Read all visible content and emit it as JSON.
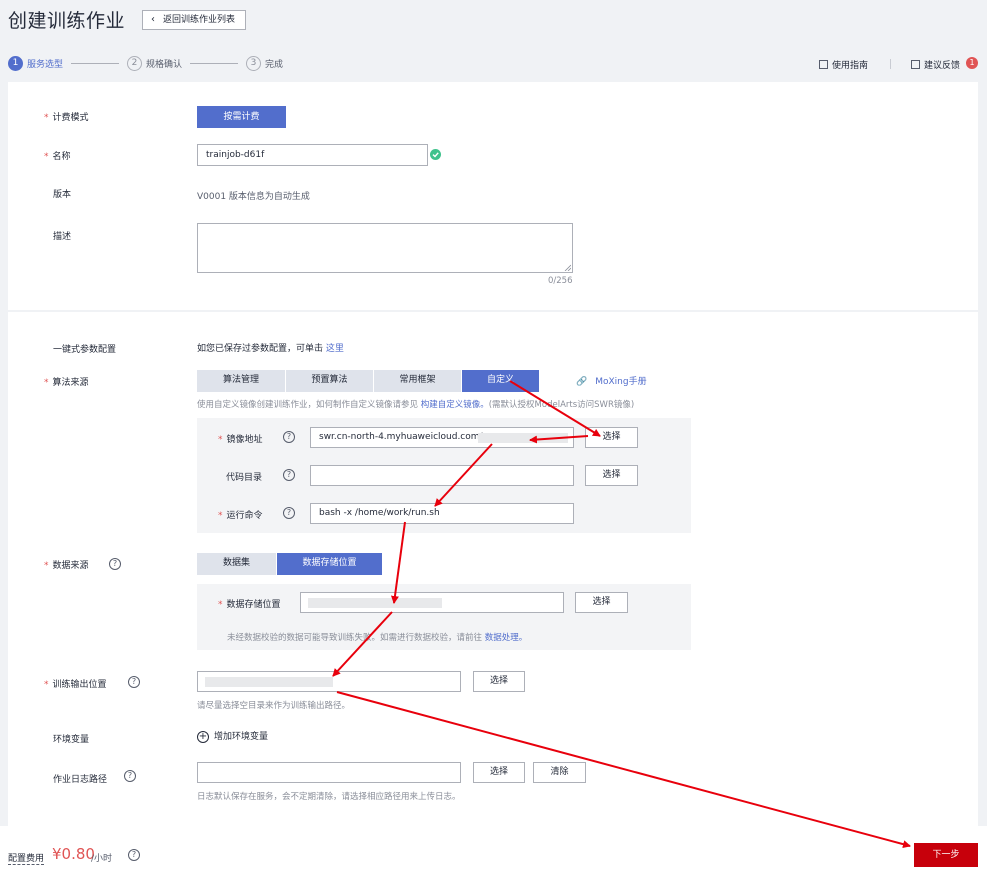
{
  "header": {
    "title": "创建训练作业",
    "back_label": "返回训练作业列表"
  },
  "steps": [
    {
      "num": "1",
      "label": "服务选型"
    },
    {
      "num": "2",
      "label": "规格确认"
    },
    {
      "num": "3",
      "label": "完成"
    }
  ],
  "top_links": {
    "guide": "使用指南",
    "feedback": "建议反馈",
    "feedback_count": "1"
  },
  "basic": {
    "billing_label": "计费模式",
    "billing_button": "按需计费",
    "name_label": "名称",
    "name_value": "trainjob-d61f",
    "version_label": "版本",
    "version_value": "V0001 版本信息为自动生成",
    "desc_label": "描述",
    "desc_counter": "0/256"
  },
  "config": {
    "oneclick_label": "一键式参数配置",
    "oneclick_text": "如您已保存过参数配置，可单击",
    "oneclick_link": "这里",
    "algo_label": "算法来源",
    "algo_tabs": [
      "算法管理",
      "预置算法",
      "常用框架",
      "自定义"
    ],
    "moxing_link": "MoXing手册",
    "algo_hint_prefix": "使用自定义镜像创建训练作业，如何制作自定义镜像请参见",
    "algo_hint_link": "构建自定义镜像。",
    "algo_hint_suffix": "(需默认授权ModelArts访问SWR镜像)",
    "image_label": "镜像地址",
    "image_value": "swr.cn-north-4.myhuaweicloud.com/",
    "code_label": "代码目录",
    "cmd_label": "运行命令",
    "cmd_value": "bash -x /home/work/run.sh",
    "select_label": "选择",
    "data_label": "数据来源",
    "data_tabs": [
      "数据集",
      "数据存储位置"
    ],
    "storage_label": "数据存储位置",
    "storage_hint_prefix": "未经数据校验的数据可能导致训练失败。如需进行数据校验，请前往",
    "storage_hint_link": "数据处理。",
    "output_label": "训练输出位置",
    "output_hint": "请尽量选择空目录来作为训练输出路径。",
    "env_label": "环境变量",
    "env_add": "增加环境变量",
    "log_label": "作业日志路径",
    "clear_label": "清除",
    "log_hint": "日志默认保存在服务，会不定期清除，请选择相应路径用来上传日志。"
  },
  "footer": {
    "cost_label": "配置费用",
    "price": "¥0.80",
    "unit": "/小时",
    "next_label": "下一步"
  },
  "colors": {
    "primary": "#526ecc",
    "danger": "#c7000b",
    "annotation": "#e8000c"
  }
}
